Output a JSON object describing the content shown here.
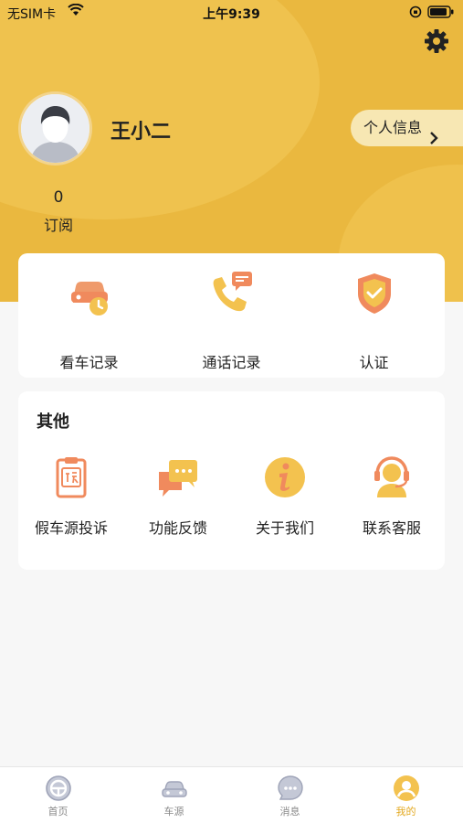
{
  "status_bar": {
    "carrier": "无SIM卡",
    "time": "上午9:39"
  },
  "profile": {
    "name": "王小二",
    "info_button": "个人信息",
    "subscriptions_count": "0",
    "subscriptions_label": "订阅"
  },
  "records": [
    {
      "label": "看车记录",
      "icon": "car-viewing-history-icon"
    },
    {
      "label": "通话记录",
      "icon": "phone-call-history-icon"
    },
    {
      "label": "认证",
      "icon": "shield-check-icon"
    }
  ],
  "others": {
    "title": "其他",
    "items": [
      {
        "label": "假车源投诉",
        "icon": "complaint-clipboard-icon"
      },
      {
        "label": "功能反馈",
        "icon": "feedback-chat-icon"
      },
      {
        "label": "关于我们",
        "icon": "info-icon"
      },
      {
        "label": "联系客服",
        "icon": "customer-service-icon"
      }
    ]
  },
  "tabbar": [
    {
      "label": "首页",
      "icon": "steering-wheel-icon",
      "active": false
    },
    {
      "label": "车源",
      "icon": "car-icon",
      "active": false
    },
    {
      "label": "消息",
      "icon": "message-icon",
      "active": false
    },
    {
      "label": "我的",
      "icon": "profile-icon",
      "active": true
    }
  ],
  "colors": {
    "accent": "#eab83f",
    "active_tab": "#e3a920",
    "icon_orange": "#f08a5d"
  }
}
